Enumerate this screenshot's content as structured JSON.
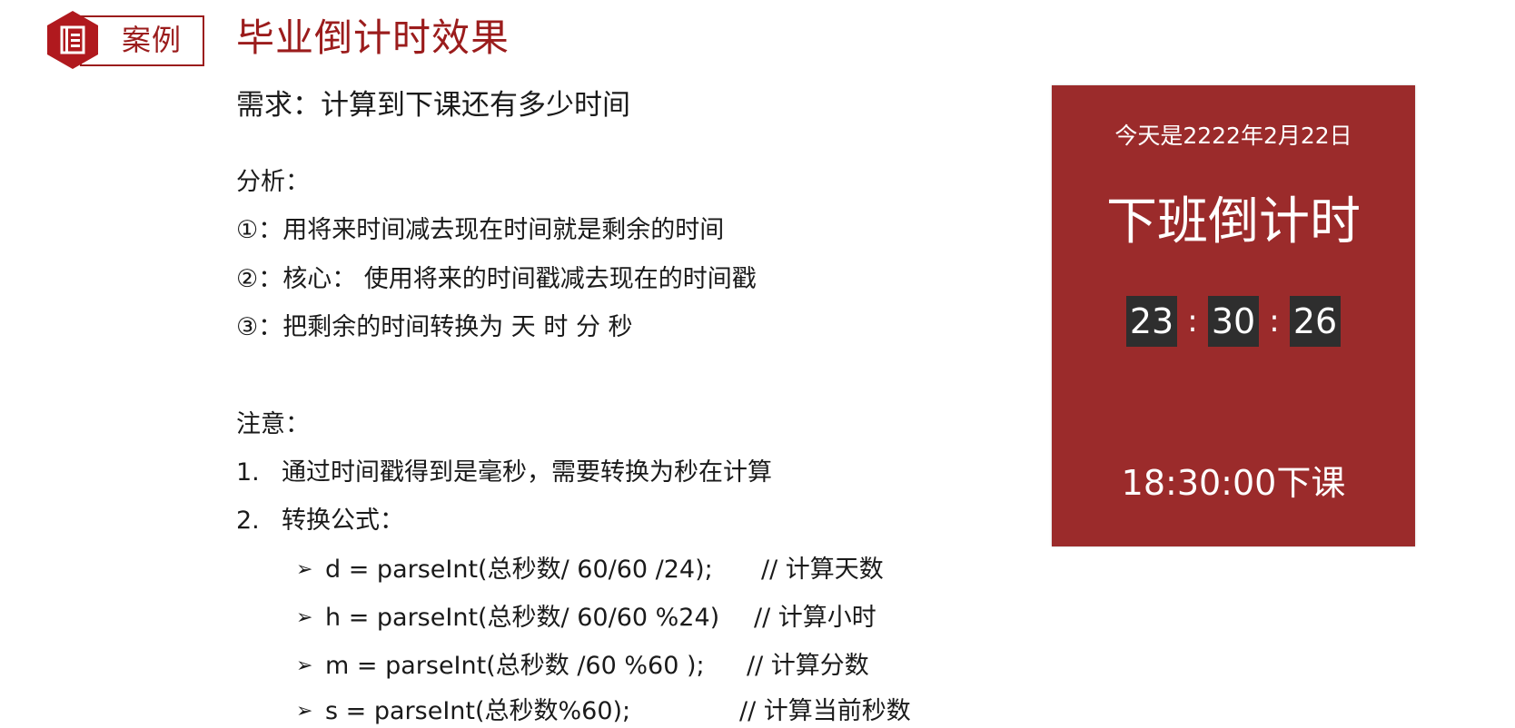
{
  "header": {
    "badge_label": "案例",
    "title": "毕业倒计时效果"
  },
  "content": {
    "requirement": "需求：计算到下课还有多少时间",
    "analysis_heading": "分析：",
    "analysis": [
      "①：用将来时间减去现在时间就是剩余的时间",
      "②：核心： 使用将来的时间戳减去现在的时间戳",
      "③：把剩余的时间转换为 天 时 分 秒"
    ],
    "notes_heading": "注意：",
    "notes": [
      {
        "num": "1.",
        "text": "通过时间戳得到是毫秒，需要转换为秒在计算"
      },
      {
        "num": "2.",
        "text": "转换公式："
      }
    ],
    "formulas": [
      {
        "code": "d = parseInt(总秒数/ 60/60 /24);",
        "comment": "//  计算天数"
      },
      {
        "code": "h = parseInt(总秒数/ 60/60 %24)",
        "comment": "//   计算小时"
      },
      {
        "code": "m = parseInt(总秒数 /60 %60 );",
        "comment": "//   计算分数"
      },
      {
        "code": "s = parseInt(总秒数%60);",
        "comment": "//   计算当前秒数"
      }
    ],
    "arrow_glyph": "➢"
  },
  "card": {
    "date": "今天是2222年2月22日",
    "heading": "下班倒计时",
    "hours": "23",
    "minutes": "30",
    "seconds": "26",
    "separator": ":",
    "end_time": "18:30:00下课"
  },
  "colors": {
    "brand_red": "#9b1c1c",
    "card_bg": "#9b2b2b",
    "digit_bg": "#2e2e2e"
  },
  "icons": {
    "badge": "document-icon"
  }
}
